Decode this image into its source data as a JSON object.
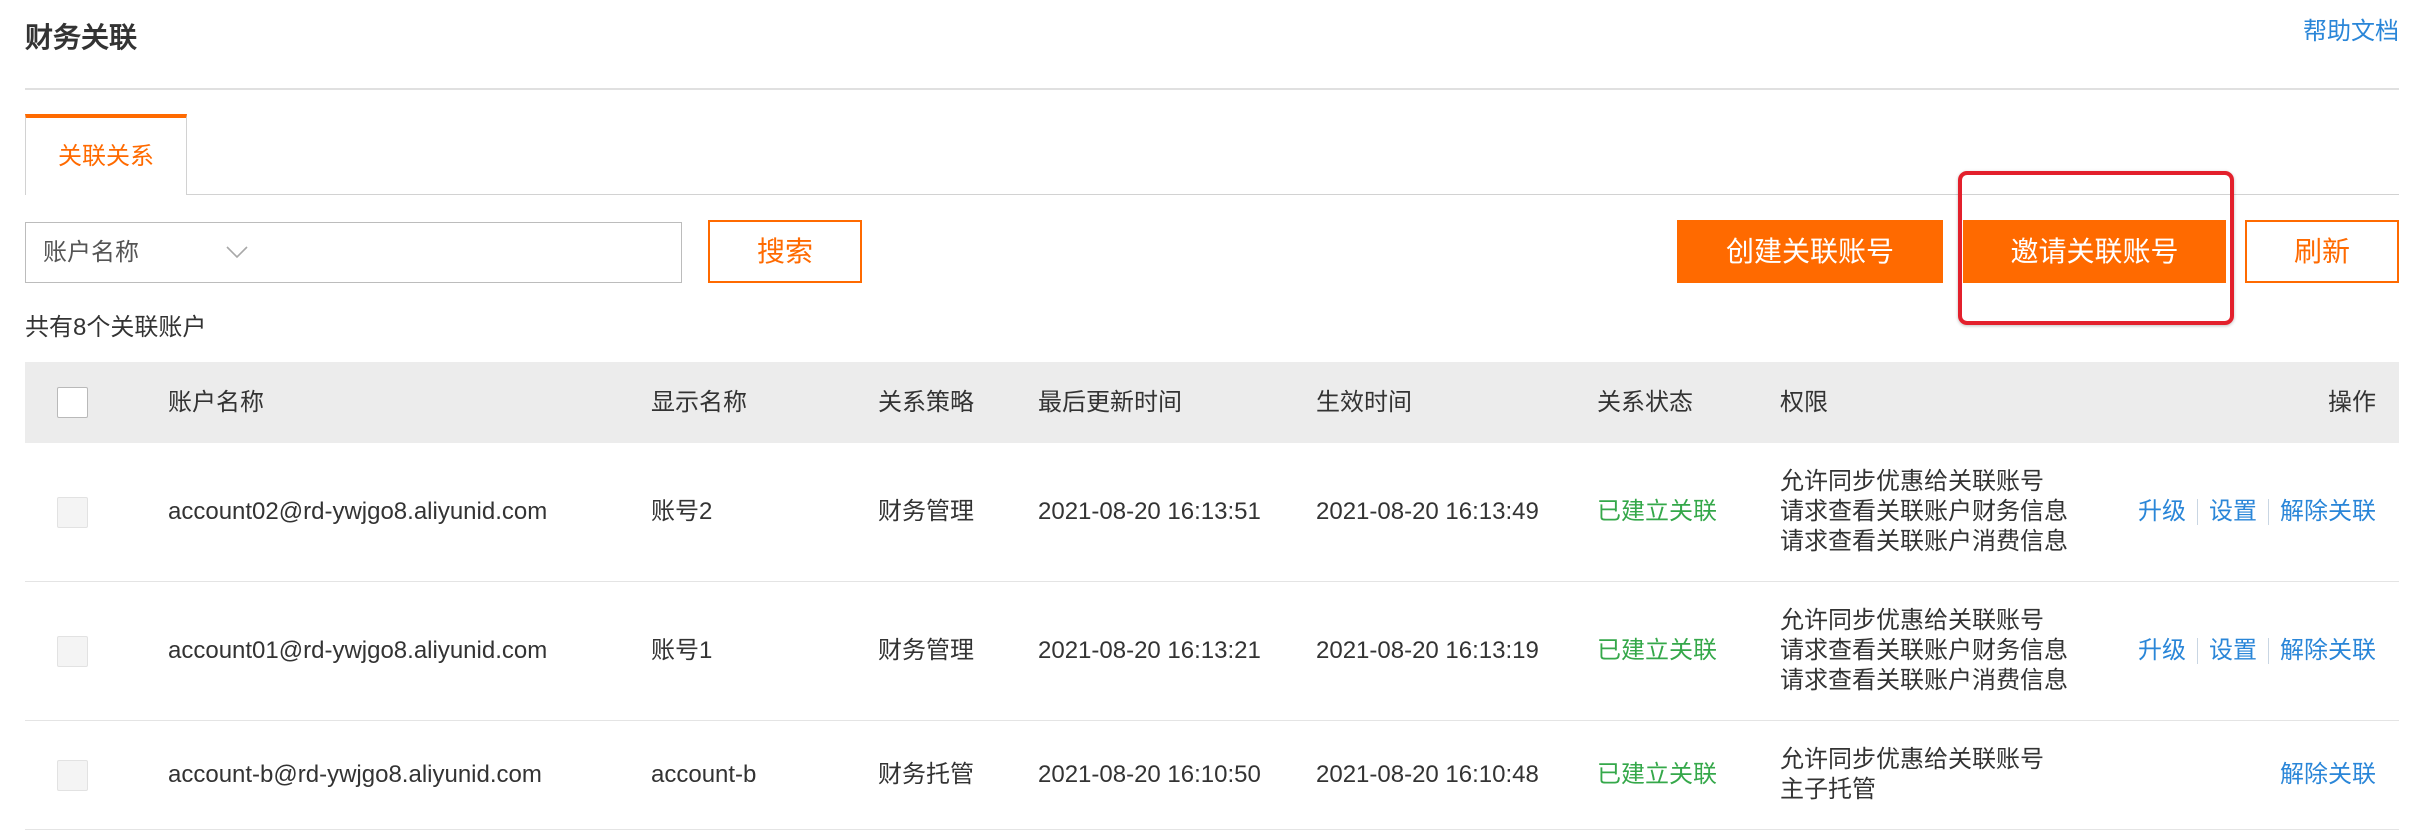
{
  "page": {
    "title": "财务关联",
    "help_link": "帮助文档"
  },
  "tabs": [
    {
      "label": "关联关系",
      "active": true
    }
  ],
  "toolbar": {
    "search": {
      "field_select": "账户名称",
      "button": "搜索"
    },
    "create_button": "创建关联账号",
    "invite_button": "邀请关联账号",
    "refresh_button": "刷新"
  },
  "summary": "共有8个关联账户",
  "table": {
    "columns": [
      "账户名称",
      "显示名称",
      "关系策略",
      "最后更新时间",
      "生效时间",
      "关系状态",
      "权限",
      "操作"
    ],
    "rows": [
      {
        "account_name": "account02@rd-ywjgo8.aliyunid.com",
        "display_name": "账号2",
        "policy": "财务管理",
        "last_updated": "2021-08-20 16:13:51",
        "effective_time": "2021-08-20 16:13:49",
        "status": "已建立关联",
        "permissions": [
          "允许同步优惠给关联账号",
          "请求查看关联账户财务信息",
          "请求查看关联账户消费信息"
        ],
        "actions": [
          "升级",
          "设置",
          "解除关联"
        ]
      },
      {
        "account_name": "account01@rd-ywjgo8.aliyunid.com",
        "display_name": "账号1",
        "policy": "财务管理",
        "last_updated": "2021-08-20 16:13:21",
        "effective_time": "2021-08-20 16:13:19",
        "status": "已建立关联",
        "permissions": [
          "允许同步优惠给关联账号",
          "请求查看关联账户财务信息",
          "请求查看关联账户消费信息"
        ],
        "actions": [
          "升级",
          "设置",
          "解除关联"
        ]
      },
      {
        "account_name": "account-b@rd-ywjgo8.aliyunid.com",
        "display_name": "account-b",
        "policy": "财务托管",
        "last_updated": "2021-08-20 16:10:50",
        "effective_time": "2021-08-20 16:10:48",
        "status": "已建立关联",
        "permissions": [
          "允许同步优惠给关联账号",
          "主子托管"
        ],
        "actions": [
          "解除关联"
        ]
      }
    ]
  },
  "colors": {
    "accent": "#ff6a00",
    "link": "#2a86d8",
    "status": "#35a84a",
    "annotation": "#e3202c",
    "header_bg": "#ececec"
  },
  "icons": {
    "select_chevron": "chevron-down-icon",
    "checkbox": "checkbox-icon"
  }
}
